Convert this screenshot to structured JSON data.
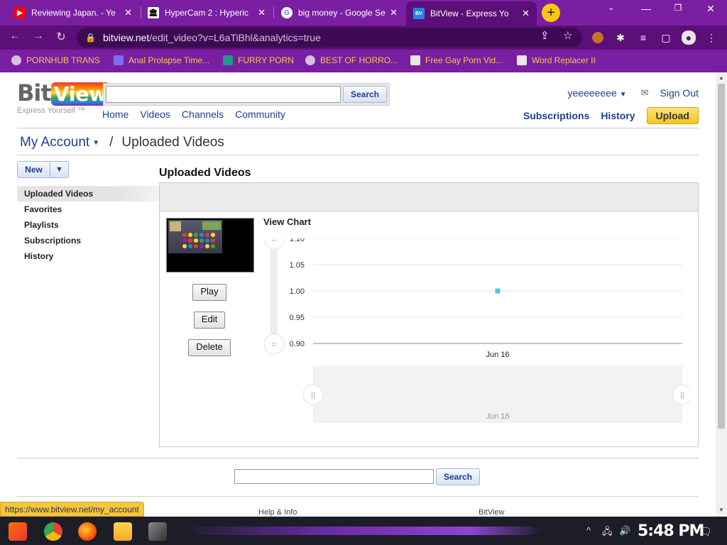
{
  "browser": {
    "tabs": [
      {
        "title": "Reviewing Japan. - Ye",
        "favicon": "youtube-icon",
        "color": "#ff0000"
      },
      {
        "title": "HyperCam 2 : Hyperic",
        "favicon": "archive-icon",
        "color": "#ffffff"
      },
      {
        "title": "big money - Google Se",
        "favicon": "google-icon",
        "color": "#4285f4"
      },
      {
        "title": "BitView - Express Yo",
        "favicon": "bitview-icon",
        "color": "#1e88e5"
      }
    ],
    "new_tab": "+",
    "url_host": "bitview.net",
    "url_path": "/edit_video?v=L6aTiBhl&analytics=true",
    "bookmarks": [
      "PORNHUB TRANS",
      "Anal Prolapse Time...",
      "FURRY PORN",
      "BEST OF HORRO...",
      "Free Gay Porn Vid...",
      "Word Replacer II"
    ],
    "status_url": "https://www.bitview.net/my_account"
  },
  "site": {
    "logo_bit": "Bit",
    "logo_view": "View",
    "tagline": "Express Yourself ™",
    "search_button": "Search",
    "nav": [
      "Home",
      "Videos",
      "Channels",
      "Community"
    ],
    "username": "yeeeeeeee",
    "sign_out": "Sign Out",
    "subscriptions": "Subscriptions",
    "history": "History",
    "upload": "Upload"
  },
  "breadcrumb": {
    "account": "My Account",
    "separator": "/",
    "current": "Uploaded Videos"
  },
  "sidebar": {
    "new_button": "New",
    "items": [
      "Uploaded Videos",
      "Favorites",
      "Playlists",
      "Subscriptions",
      "History"
    ],
    "active_index": 0
  },
  "content": {
    "title": "Uploaded Videos",
    "buttons": {
      "play": "Play",
      "edit": "Edit",
      "delete": "Delete"
    },
    "chart_title": "View Chart"
  },
  "chart_data": {
    "type": "line",
    "title": "View Chart",
    "x": [
      "Jun 16"
    ],
    "series": [
      {
        "values": [
          1.0
        ],
        "color": "#5bc0de"
      }
    ],
    "yticks": [
      "1.10",
      "1.05",
      "1.00",
      "0.95",
      "0.90"
    ],
    "ylim": [
      0.9,
      1.1
    ],
    "navigator_label": "Jun 16",
    "grid": true
  },
  "footer": {
    "search_button": "Search",
    "links": [
      "Help & Info",
      "BitView"
    ]
  },
  "taskbar": {
    "clock": "5:48 PM"
  }
}
